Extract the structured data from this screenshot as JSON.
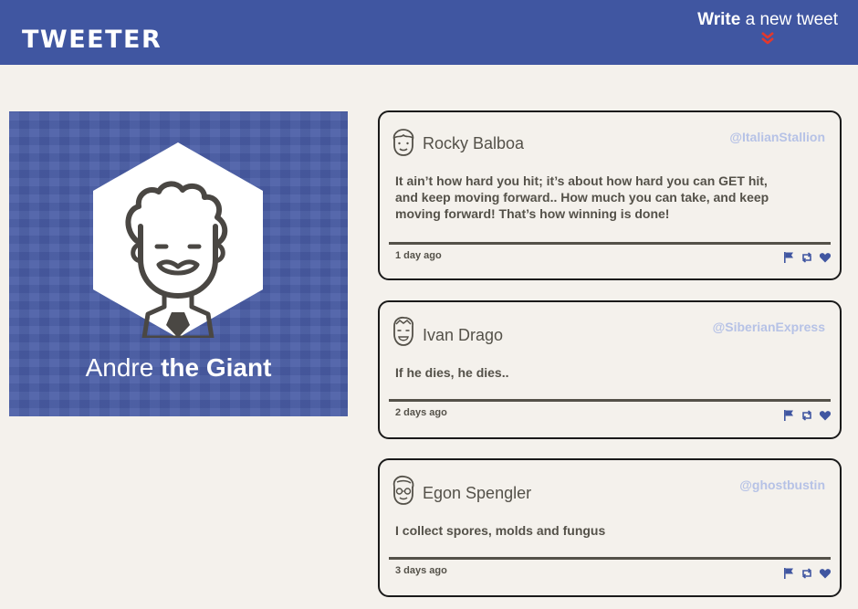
{
  "nav": {
    "brand": "TWEETER",
    "compose_strong": "Write",
    "compose_rest": " a new tweet",
    "chevron_color": "#e4382c"
  },
  "profile": {
    "first_name": "Andre",
    "last_name": "the Giant",
    "background_color": "#4a5da6"
  },
  "tweets": [
    {
      "name": "Rocky Balboa",
      "handle": "@ItalianStallion",
      "text": "It ain’t how hard you hit; it’s about how hard you can GET hit, and keep moving forward.. How much you can take, and keep moving forward! That’s how winning is done!",
      "time": "1 day ago"
    },
    {
      "name": "Ivan Drago",
      "handle": "@SiberianExpress",
      "text": "If he dies, he dies..",
      "time": "2 days ago"
    },
    {
      "name": "Egon Spengler",
      "handle": "@ghostbustin",
      "text": "I collect spores, molds and fungus",
      "time": "3 days ago"
    }
  ],
  "icons": {
    "action_color": "#4056a1",
    "actions": [
      "flag-icon",
      "retweet-icon",
      "heart-icon"
    ]
  }
}
